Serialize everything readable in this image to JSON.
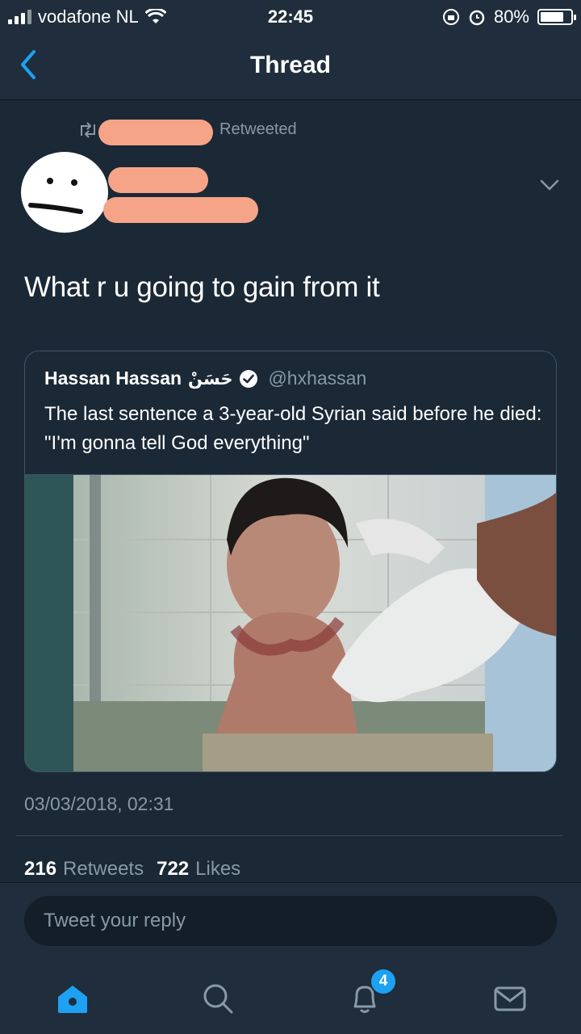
{
  "status_bar": {
    "carrier": "vodafone NL",
    "time": "22:45",
    "battery": "80%",
    "battery_level": 0.8
  },
  "nav": {
    "title": "Thread"
  },
  "tweet": {
    "retweet_label": "Retweeted",
    "text": "What r u going to gain from it",
    "timestamp": "03/03/2018, 02:31",
    "retweets_count": "216",
    "retweets_label": "Retweets",
    "likes_count": "722",
    "likes_label": "Likes"
  },
  "quote": {
    "name": "Hassan Hassan",
    "name_arabic": "حَسَنْ",
    "handle": "@hxhassan",
    "text": "The last sentence a 3-year-old Syrian said before he died: \"I'm gonna tell God everything\""
  },
  "reply": {
    "placeholder": "Tweet your reply"
  },
  "tabs": {
    "notifications_badge": "4"
  },
  "colors": {
    "background": "#1b2836",
    "accent": "#1da1f2",
    "muted_text": "#8899a6",
    "redaction": "#f5a487"
  }
}
